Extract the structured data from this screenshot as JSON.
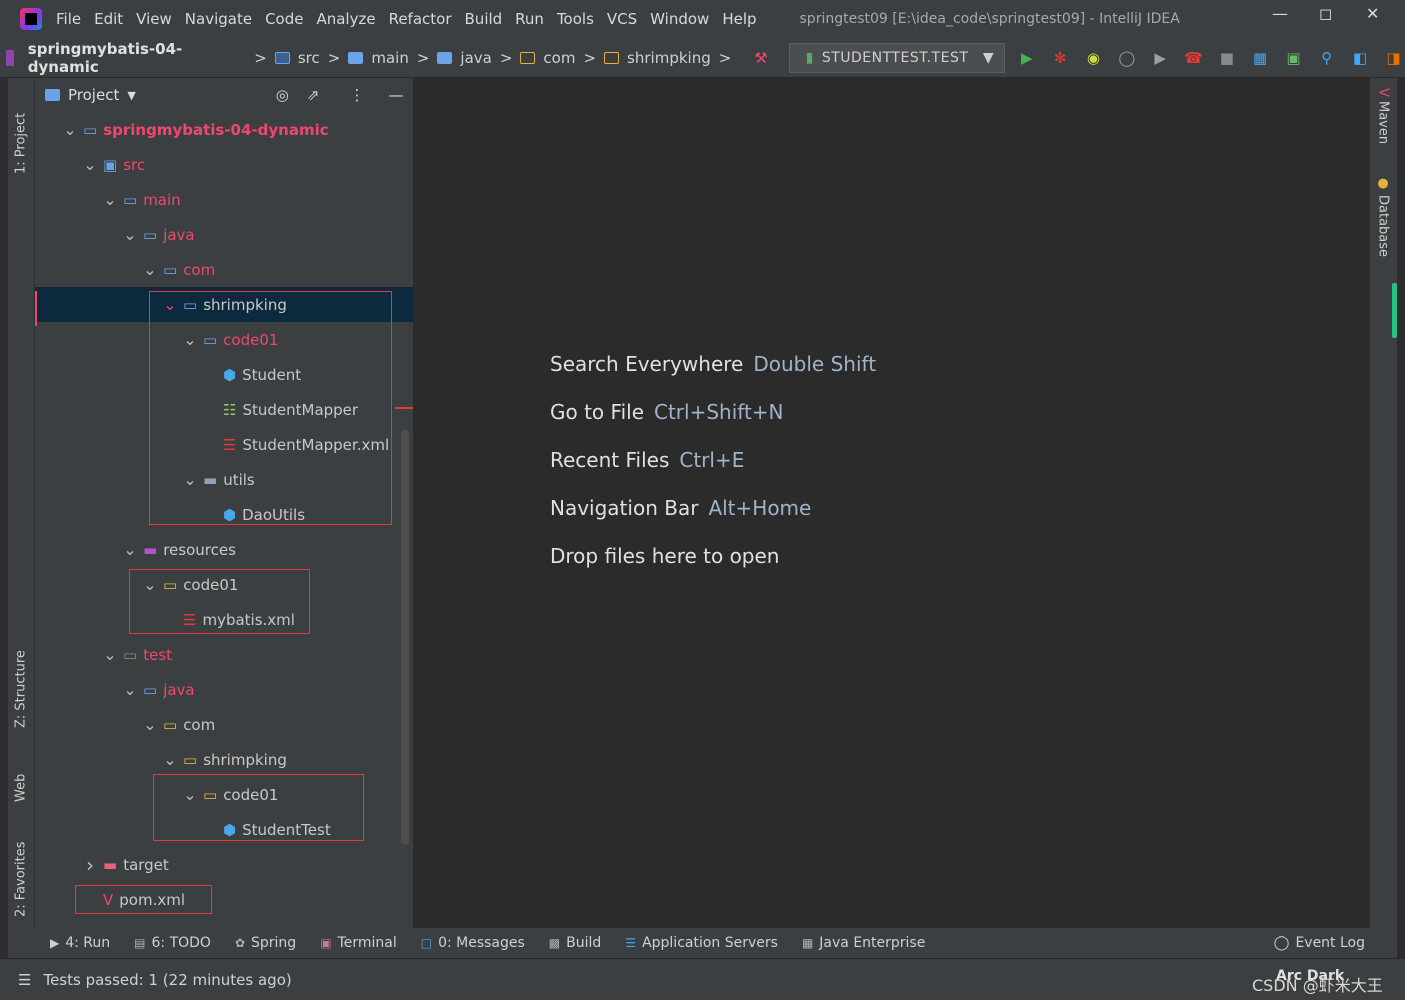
{
  "menubar": {
    "items": [
      "File",
      "Edit",
      "View",
      "Navigate",
      "Code",
      "Analyze",
      "Refactor",
      "Build",
      "Run",
      "Tools",
      "VCS",
      "Window",
      "Help"
    ],
    "window_title": "springtest09 [E:\\idea_code\\springtest09] - IntelliJ IDEA"
  },
  "navbar": {
    "crumbs": [
      "springmybatis-04-dynamic",
      "src",
      "main",
      "java",
      "com",
      "shrimpking"
    ],
    "run_config": "STUDENTTEST.TEST"
  },
  "left_tabs": {
    "project": "1: Project",
    "structure": "Z: Structure",
    "web": "Web",
    "favorites": "2: Favorites"
  },
  "right_tabs": {
    "maven": "Maven",
    "database": "Database"
  },
  "project": {
    "header": "Project",
    "tree": [
      {
        "label": "springmybatis-04-dynamic",
        "depth": 0,
        "arrow": "down",
        "icon": "folder",
        "color": "pink",
        "bold": true
      },
      {
        "label": "src",
        "depth": 1,
        "arrow": "down",
        "icon": "src",
        "color": "pink"
      },
      {
        "label": "main",
        "depth": 2,
        "arrow": "down",
        "icon": "folder",
        "color": "pink"
      },
      {
        "label": "java",
        "depth": 3,
        "arrow": "down",
        "icon": "folder",
        "color": "pink"
      },
      {
        "label": "com",
        "depth": 4,
        "arrow": "down",
        "icon": "folder",
        "color": "pink"
      },
      {
        "label": "shrimpking",
        "depth": 5,
        "arrow": "down",
        "icon": "folder",
        "color": "plain",
        "selected": true
      },
      {
        "label": "code01",
        "depth": 6,
        "arrow": "down",
        "icon": "folder",
        "color": "pink"
      },
      {
        "label": "Student",
        "depth": 7,
        "arrow": "",
        "icon": "class",
        "color": "plain"
      },
      {
        "label": "StudentMapper",
        "depth": 7,
        "arrow": "",
        "icon": "mapper",
        "color": "plain"
      },
      {
        "label": "StudentMapper.xml",
        "depth": 7,
        "arrow": "",
        "icon": "xml",
        "color": "plain"
      },
      {
        "label": "utils",
        "depth": 6,
        "arrow": "down",
        "icon": "folder-gray",
        "color": "plain"
      },
      {
        "label": "DaoUtils",
        "depth": 7,
        "arrow": "",
        "icon": "class",
        "color": "plain"
      },
      {
        "label": "resources",
        "depth": 3,
        "arrow": "down",
        "icon": "resources",
        "color": "plain"
      },
      {
        "label": "code01",
        "depth": 4,
        "arrow": "down",
        "icon": "folder-yel",
        "color": "plain"
      },
      {
        "label": "mybatis.xml",
        "depth": 5,
        "arrow": "",
        "icon": "xml",
        "color": "plain"
      },
      {
        "label": "test",
        "depth": 2,
        "arrow": "down",
        "icon": "folder-test",
        "color": "pink"
      },
      {
        "label": "java",
        "depth": 3,
        "arrow": "down",
        "icon": "folder",
        "color": "pink"
      },
      {
        "label": "com",
        "depth": 4,
        "arrow": "down",
        "icon": "folder-yel",
        "color": "plain"
      },
      {
        "label": "shrimpking",
        "depth": 5,
        "arrow": "down",
        "icon": "folder-yel",
        "color": "plain"
      },
      {
        "label": "code01",
        "depth": 6,
        "arrow": "down",
        "icon": "folder-yel",
        "color": "plain"
      },
      {
        "label": "StudentTest",
        "depth": 7,
        "arrow": "",
        "icon": "class-test",
        "color": "plain"
      },
      {
        "label": "target",
        "depth": 1,
        "arrow": "right",
        "icon": "folder-red",
        "color": "plain"
      },
      {
        "label": "pom.xml",
        "depth": 1,
        "arrow": "",
        "icon": "maven",
        "color": "plain"
      }
    ]
  },
  "editor_hints": [
    {
      "label": "Search Everywhere",
      "shortcut": "Double Shift"
    },
    {
      "label": "Go to File",
      "shortcut": "Ctrl+Shift+N"
    },
    {
      "label": "Recent Files",
      "shortcut": "Ctrl+E"
    },
    {
      "label": "Navigation Bar",
      "shortcut": "Alt+Home"
    },
    {
      "label": "Drop files here to open",
      "shortcut": ""
    }
  ],
  "toolwindows": [
    "4: Run",
    "6: TODO",
    "Spring",
    "Terminal",
    "0: Messages",
    "Build",
    "Application Servers",
    "Java Enterprise"
  ],
  "event_log": "Event Log",
  "status": "Tests passed: 1 (22 minutes ago)",
  "watermark": "CSDN @虾米大王",
  "theme_label": "Arc Dark"
}
